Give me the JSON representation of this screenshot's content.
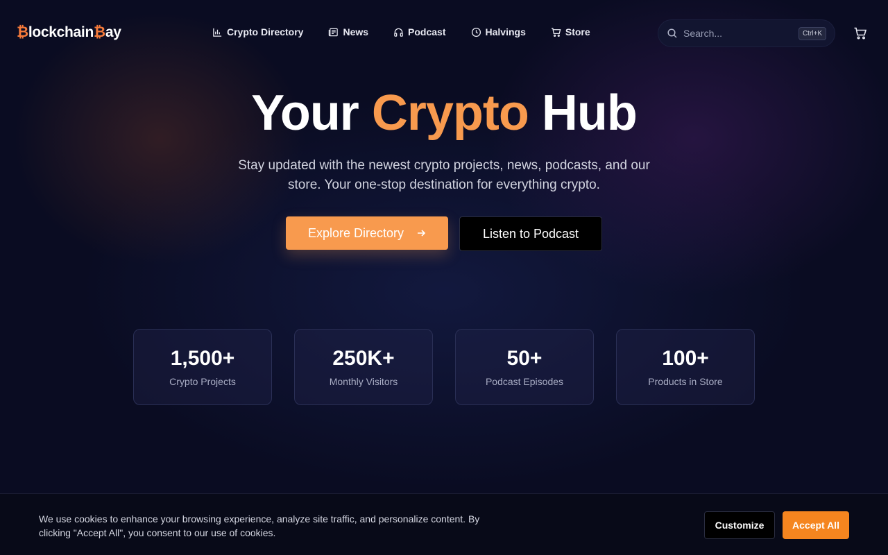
{
  "brand": {
    "prefix": "₿",
    "part1": "lockchain",
    "mid": "₿",
    "part2": "ay"
  },
  "nav": {
    "items": [
      {
        "label": "Crypto Directory",
        "icon": "bar-chart-icon"
      },
      {
        "label": "News",
        "icon": "newspaper-icon"
      },
      {
        "label": "Podcast",
        "icon": "headphones-icon"
      },
      {
        "label": "Halvings",
        "icon": "clock-icon"
      },
      {
        "label": "Store",
        "icon": "cart-icon"
      }
    ],
    "search": {
      "placeholder": "Search...",
      "shortcut": "Ctrl+K"
    }
  },
  "hero": {
    "title_start": "Your",
    "title_accent": "Crypto",
    "title_end": "Hub",
    "subtitle": "Stay updated with the newest crypto projects, news, podcasts, and our store. Your one-stop destination for everything crypto.",
    "primary_cta": "Explore Directory",
    "secondary_cta": "Listen to Podcast"
  },
  "stats": [
    {
      "value": "1,500+",
      "label": "Crypto Projects"
    },
    {
      "value": "250K+",
      "label": "Monthly Visitors"
    },
    {
      "value": "50+",
      "label": "Podcast Episodes"
    },
    {
      "value": "100+",
      "label": "Products in Store"
    }
  ],
  "cookie": {
    "text": "We use cookies to enhance your browsing experience, analyze site traffic, and personalize content. By clicking \"Accept All\", you consent to our use of cookies.",
    "customize": "Customize",
    "accept": "Accept All"
  },
  "colors": {
    "accent": "#f89a4e",
    "accept": "#f5851f",
    "background": "#0a0c22"
  }
}
